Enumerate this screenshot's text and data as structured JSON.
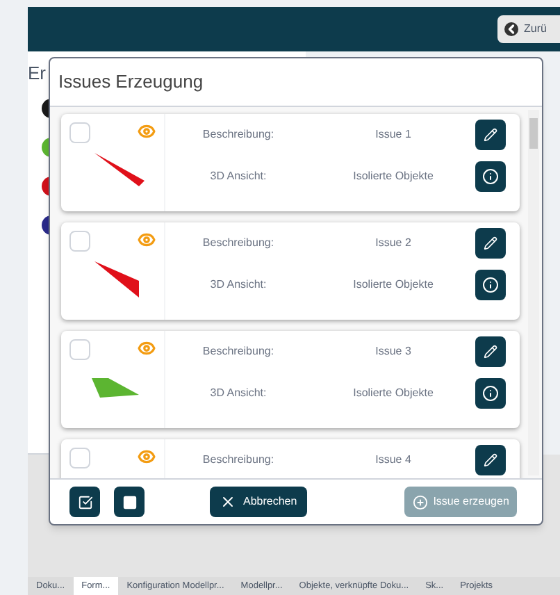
{
  "header": {
    "back_button": "Zurü"
  },
  "page": {
    "heading": "Er",
    "dots": [
      {
        "color": "#1a1a1a"
      },
      {
        "color": "#5cb531"
      },
      {
        "color": "#d0101a"
      },
      {
        "color": "#2a2a8a"
      }
    ]
  },
  "dialog": {
    "title": "Issues Erzeugung",
    "issues": [
      {
        "checked": false,
        "description_label": "Beschreibung:",
        "description": "Issue 1",
        "view_label": "3D Ansicht:",
        "view": "Isolierte Objekte",
        "color": "#e0101a",
        "kind": "sliver"
      },
      {
        "checked": false,
        "description_label": "Beschreibung:",
        "description": "Issue 2",
        "view_label": "3D Ansicht:",
        "view": "Isolierte Objekte",
        "color": "#e0101a",
        "kind": "wedge"
      },
      {
        "checked": false,
        "description_label": "Beschreibung:",
        "description": "Issue 3",
        "view_label": "3D Ansicht:",
        "view": "Isolierte Objekte",
        "color": "#5cb531",
        "kind": "trapezoid"
      },
      {
        "checked": false,
        "description_label": "Beschreibung:",
        "description": "Issue 4"
      }
    ],
    "cancel_button": "Abbrechen",
    "create_button": {
      "label": "Issue erzeugen",
      "disabled": true
    }
  },
  "tabs": [
    {
      "label": "Doku...",
      "selected": false
    },
    {
      "label": "Form...",
      "selected": true
    },
    {
      "label": "Konfiguration Modellpr...",
      "selected": false
    },
    {
      "label": "Modellpr...",
      "selected": false
    },
    {
      "label": "Objekte, verknüpfte Doku...",
      "selected": false
    },
    {
      "label": "Sk...",
      "selected": false
    },
    {
      "label": "Projekts",
      "selected": false
    }
  ]
}
